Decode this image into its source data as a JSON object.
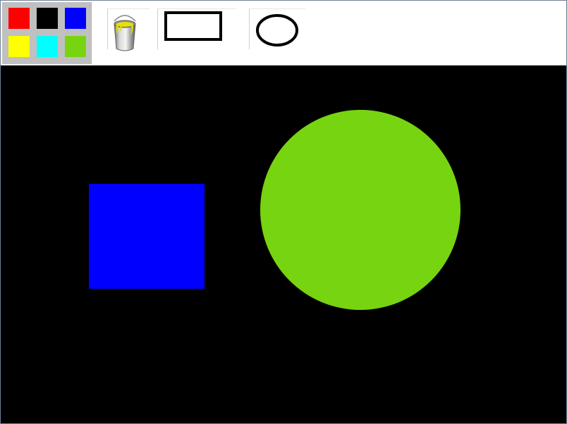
{
  "palette": {
    "colors": [
      {
        "name": "red",
        "hex": "#ff0000"
      },
      {
        "name": "black",
        "hex": "#000000"
      },
      {
        "name": "blue",
        "hex": "#0000ff"
      },
      {
        "name": "yellow",
        "hex": "#ffff00"
      },
      {
        "name": "cyan",
        "hex": "#00ffff"
      },
      {
        "name": "green",
        "hex": "#77d411"
      }
    ]
  },
  "tools": [
    {
      "name": "fill-tool",
      "icon": "paint-bucket-icon"
    },
    {
      "name": "rectangle-tool",
      "icon": "rectangle-icon"
    },
    {
      "name": "ellipse-tool",
      "icon": "ellipse-icon"
    }
  ],
  "canvas": {
    "background": "#000000",
    "shapes": [
      {
        "type": "rectangle",
        "fill": "#0000ff"
      },
      {
        "type": "circle",
        "fill": "#77d411"
      }
    ]
  }
}
